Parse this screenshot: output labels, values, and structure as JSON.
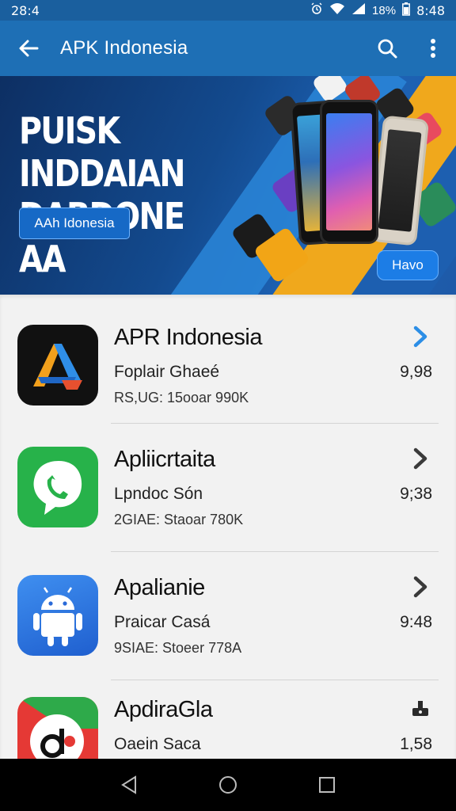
{
  "status_bar": {
    "time_left": "28:4",
    "battery": "18%",
    "time_right": "8:48"
  },
  "app_bar": {
    "title": "APK Indonesia"
  },
  "banner": {
    "headline_line1": "PUISK INDDAIAN",
    "headline_line2": "DABDONE AA",
    "pill_label": "AAh Idonesia",
    "more_label": "Havo"
  },
  "apps": [
    {
      "name": "APR Indonesia",
      "subtitle": "Foplair Ghaeé",
      "meta": "RS,UG: 15ooar 990K",
      "value": "9,98",
      "action": "chevron-right-blue"
    },
    {
      "name": "Apliicrtaita",
      "subtitle": "Lpndoc Són",
      "meta": "2GIAE: Staoar 780K",
      "value": "9;38",
      "action": "chevron-right-dark"
    },
    {
      "name": "Apalianie",
      "subtitle": "Praicar Casá",
      "meta": "9SIAE: Stoeer 778A",
      "value": "9:48",
      "action": "chevron-right-dark"
    },
    {
      "name": "ApdiraGla",
      "subtitle": "Oaein Saca",
      "meta": "",
      "value": "1,58",
      "action": "download-icon"
    }
  ],
  "colors": {
    "app_bar": "#1e6fb5",
    "accent": "#1c7de6",
    "background": "#f2f2f2"
  }
}
